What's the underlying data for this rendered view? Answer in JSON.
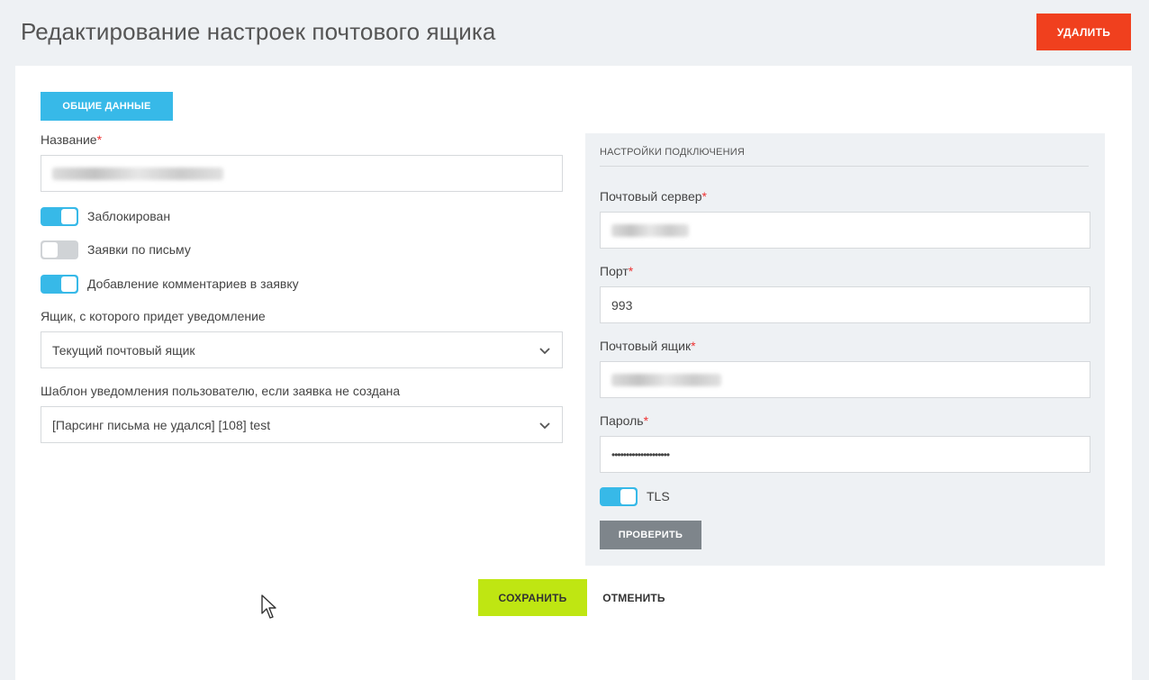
{
  "header": {
    "title": "Редактирование настроек почтового ящика",
    "delete_label": "УДАЛИТЬ",
    "delete_color": "#f0401e"
  },
  "tabs": [
    {
      "label": "ОБЩИЕ ДАННЫЕ",
      "active": true
    }
  ],
  "form": {
    "name_label": "Название",
    "required_mark": "*",
    "toggles": [
      {
        "label": "Заблокирован",
        "on": true
      },
      {
        "label": "Заявки по письму",
        "on": false
      },
      {
        "label": "Добавление комментариев в заявку",
        "on": true
      }
    ],
    "notify_box_label": "Ящик, с которого придет уведомление",
    "notify_box_value": "Текущий почтовый ящик",
    "template_label": "Шаблон уведомления пользователю, если заявка не создана",
    "template_value": "[Парсинг письма не удался] [108] test"
  },
  "connection": {
    "title": "НАСТРОЙКИ ПОДКЛЮЧЕНИЯ",
    "server_label": "Почтовый сервер",
    "port_label": "Порт",
    "port_value": "993",
    "mailbox_label": "Почтовый ящик",
    "password_label": "Пароль",
    "password_value": "••••••••••••••••••••",
    "tls_label": "TLS",
    "tls_on": true,
    "check_label": "ПРОВЕРИТЬ"
  },
  "footer": {
    "save_label": "СОХРАНИТЬ",
    "cancel_label": "ОТМЕНИТЬ",
    "save_color": "#bfe612"
  },
  "colors": {
    "accent": "#37b9e8",
    "required": "#e33333"
  },
  "icons": {
    "select_arrow": "chevron-down-icon",
    "pointer": "mouse-cursor-icon"
  }
}
